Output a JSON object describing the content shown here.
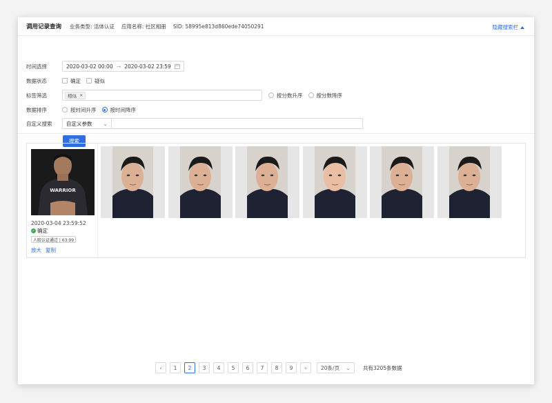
{
  "header": {
    "title": "调用记录查询",
    "biz_type": "业务类型:  活体认证",
    "app_name": "应用名称:  社区相册",
    "sid": "SID:  58995e813d860ede74050291",
    "toggle_label": "隐藏搜索栏"
  },
  "filters": {
    "time_label": "时间选择",
    "time_start": "2020-03-02 00:00",
    "time_end": "2020-03-02 23:59",
    "status_label": "数据状态",
    "status_options": [
      "确定",
      "疑似"
    ],
    "tag_label": "标签筛选",
    "tag_value": "相似",
    "score_sort_options": [
      "按分数升序",
      "按分数降序"
    ],
    "sort_label": "数据排序",
    "sort_options": [
      "按时间升序",
      "按时间降序"
    ],
    "sort_selected": "按时间降序",
    "custom_label": "自定义搜索",
    "custom_param": "自定义参数",
    "search_button": "搜索"
  },
  "result": {
    "timestamp": "2020-03-04 23:59:52",
    "status": "确定",
    "badge": "人脸认证通过 | 63.99",
    "actions": [
      "放大",
      "复制"
    ],
    "profile_shirt_text": "WARRIOR",
    "thumb_count": 6
  },
  "pagination": {
    "pages": [
      "1",
      "2",
      "3",
      "4",
      "5",
      "6",
      "7",
      "8",
      "9"
    ],
    "current": "2",
    "page_size": "20条/页",
    "total": "共有3205条数据"
  },
  "colors": {
    "accent": "#2f6de1",
    "success": "#3aa956"
  }
}
